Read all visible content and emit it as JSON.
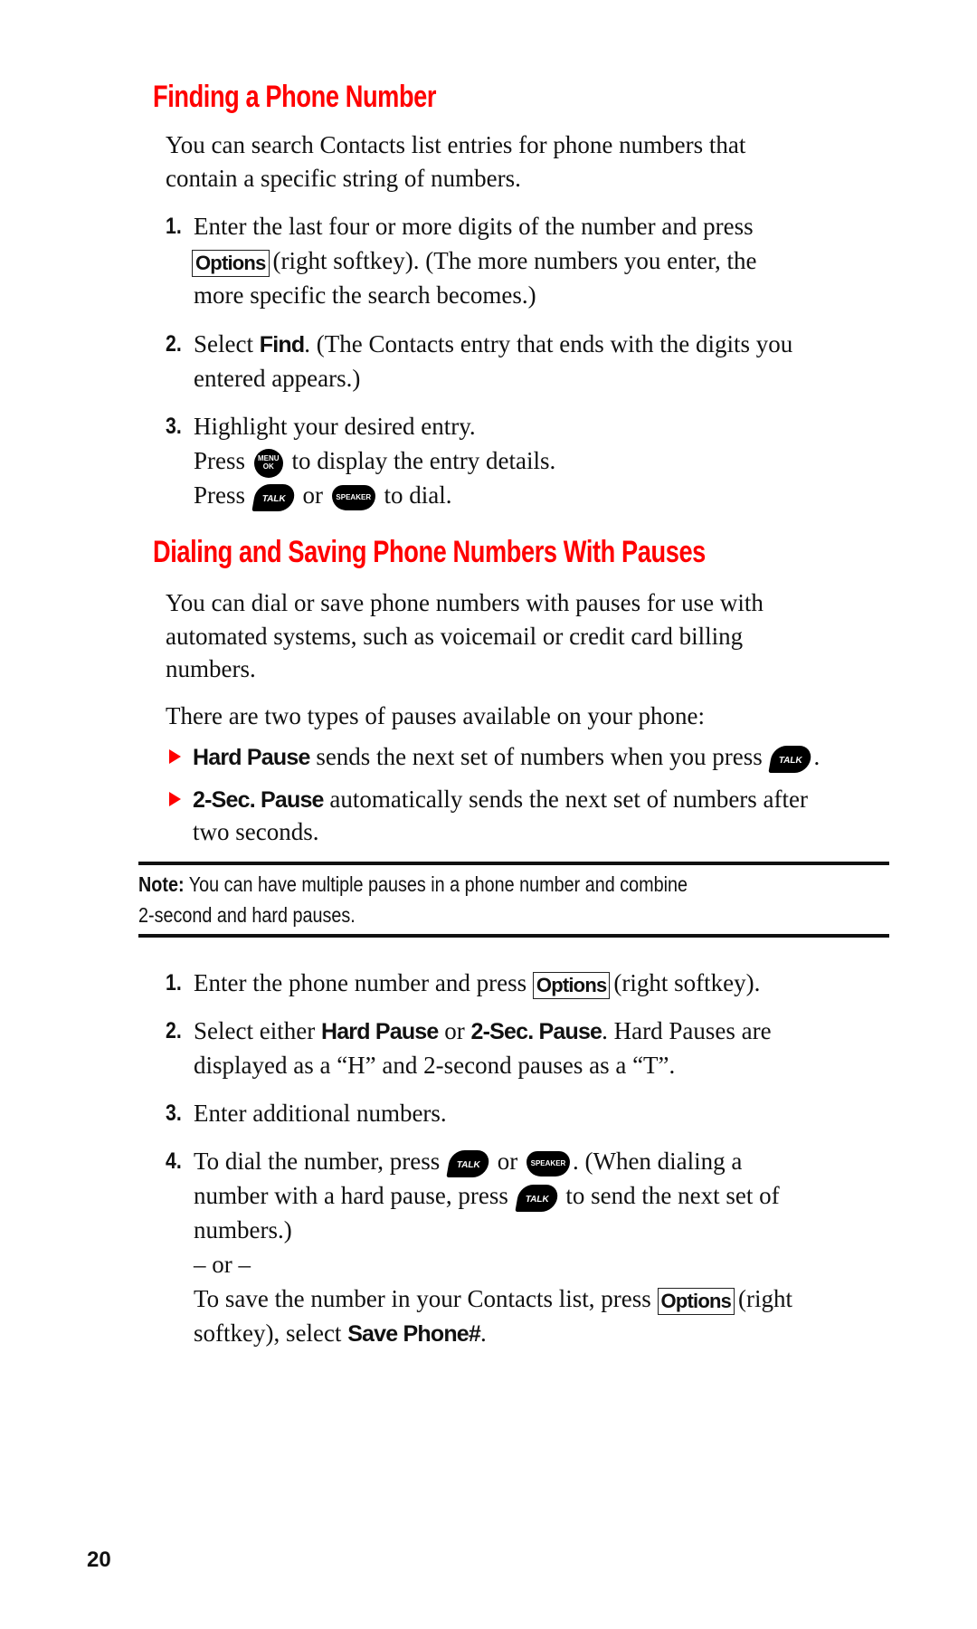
{
  "page_number": "20",
  "section1": {
    "heading": "Finding a Phone Number",
    "intro_lines": [
      "You can search Contacts list entries for phone numbers that",
      "contain a specific string of numbers."
    ],
    "steps": [
      {
        "num": "1.",
        "line1": "Enter the last four or more digits of the number and press",
        "key": "Options",
        "line2_after_key": "(right softkey). (The more numbers you enter, the",
        "line3": "more specific the search becomes.)"
      },
      {
        "num": "2.",
        "pre": "Select ",
        "bold": "Find",
        "post": ". (The Contacts entry that ends with the digits you",
        "line2": "entered appears.)"
      },
      {
        "num": "3.",
        "line1": "Highlight your desired entry.",
        "line2_pre": "Press",
        "line2_post": "to display the entry details.",
        "line3_pre": "Press",
        "line3_mid": "or",
        "line3_post": "to dial."
      }
    ]
  },
  "section2": {
    "heading": "Dialing and Saving Phone Numbers With Pauses",
    "intro_lines": [
      "You can dial or save phone numbers with pauses for use with",
      "automated systems, such as voicemail or credit card billing",
      "numbers."
    ],
    "types_intro": "There are two types of pauses available on your phone:",
    "bullets": [
      {
        "bold": "Hard Pause",
        "text": " sends the next set of numbers when you press",
        "end": "."
      },
      {
        "bold": "2-Sec. Pause",
        "text": " automatically sends the next set of numbers after",
        "line2": "two seconds."
      }
    ],
    "note": {
      "label": "Note:",
      "line1": " You can have multiple pauses in a phone number and combine",
      "line2": "2-second and hard pauses."
    },
    "steps": [
      {
        "num": "1.",
        "pre": "Enter the phone number and press",
        "key": "Options",
        "post": "(right softkey)."
      },
      {
        "num": "2.",
        "pre": "Select either ",
        "bold1": "Hard Pause",
        "mid": " or ",
        "bold2": "2-Sec. Pause",
        "post": ". Hard Pauses are",
        "line2": "displayed as a “H” and 2-second pauses as a “T”."
      },
      {
        "num": "3.",
        "line1": "Enter additional numbers."
      },
      {
        "num": "4.",
        "line1_pre": "To dial the number, press",
        "line1_mid": "or",
        "line1_post": ". (When dialing a",
        "line2_pre": "number with a hard pause, press",
        "line2_post": "to send the next set of",
        "line3": "numbers.)",
        "or_line": "– or –",
        "line5_pre": "To save the number in your Contacts list, press",
        "key": "Options",
        "line5_post": "(right",
        "line6_pre": "softkey), select ",
        "line6_bold": "Save Phone#",
        "line6_end": "."
      }
    ]
  },
  "buttons": {
    "menu_top": "MENU",
    "menu_bottom": "OK",
    "talk": "TALK",
    "speaker": "SPEAKER"
  },
  "colors": {
    "heading": "#ff0000",
    "bullet": "#ff0000",
    "text": "#111111"
  }
}
